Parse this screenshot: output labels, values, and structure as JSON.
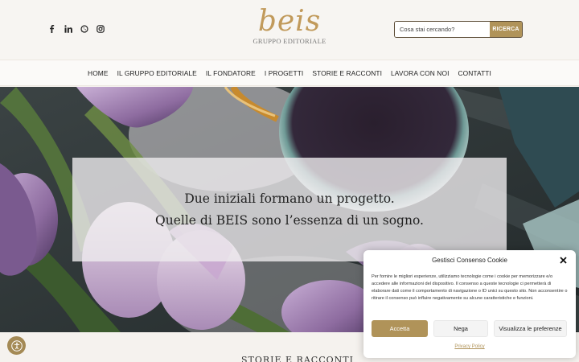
{
  "header": {
    "socials": [
      {
        "icon": "facebook-icon",
        "glyph": "f"
      },
      {
        "icon": "linkedin-icon",
        "glyph": "in"
      },
      {
        "icon": "whatsapp-icon",
        "glyph": "wa"
      },
      {
        "icon": "instagram-icon",
        "glyph": "ig"
      }
    ],
    "logo_mark": "beis",
    "logo_subtitle": "GRUPPO EDITORIALE",
    "search": {
      "placeholder": "Cosa stai cercando?",
      "button_label": "RICERCA"
    }
  },
  "nav": {
    "items": [
      "HOME",
      "IL GRUPPO EDITORIALE",
      "IL FONDATORE",
      "I PROGETTI",
      "STORIE E RACCONTI",
      "LAVORA CON NOI",
      "CONTATTI"
    ]
  },
  "hero": {
    "line1": "Due iniziali formano un progetto.",
    "line2": "Quelle di BEIS sono l’essenza di un sogno."
  },
  "section_peek": "STORIE E RACCONTI",
  "accessibility": {
    "icon": "accessibility-icon"
  },
  "cookie": {
    "title": "Gestisci Consenso Cookie",
    "text": "Per fornire le migliori esperienze, utilizziamo tecnologie come i cookie per memorizzare e/o accedere alle informazioni del dispositivo. Il consenso a queste tecnologie ci permetterà di elaborare dati come il comportamento di navigazione o ID unici su questo sito. Non acconsentire o ritirare il consenso può influire negativamente su alcune caratteristiche e funzioni.",
    "accept_label": "Accetta",
    "deny_label": "Nega",
    "prefs_label": "Visualizza le preferenze",
    "policy_link": "Privacy Policy"
  },
  "colors": {
    "accent": "#b09359",
    "logo": "#c19a5b",
    "text": "#222222"
  }
}
